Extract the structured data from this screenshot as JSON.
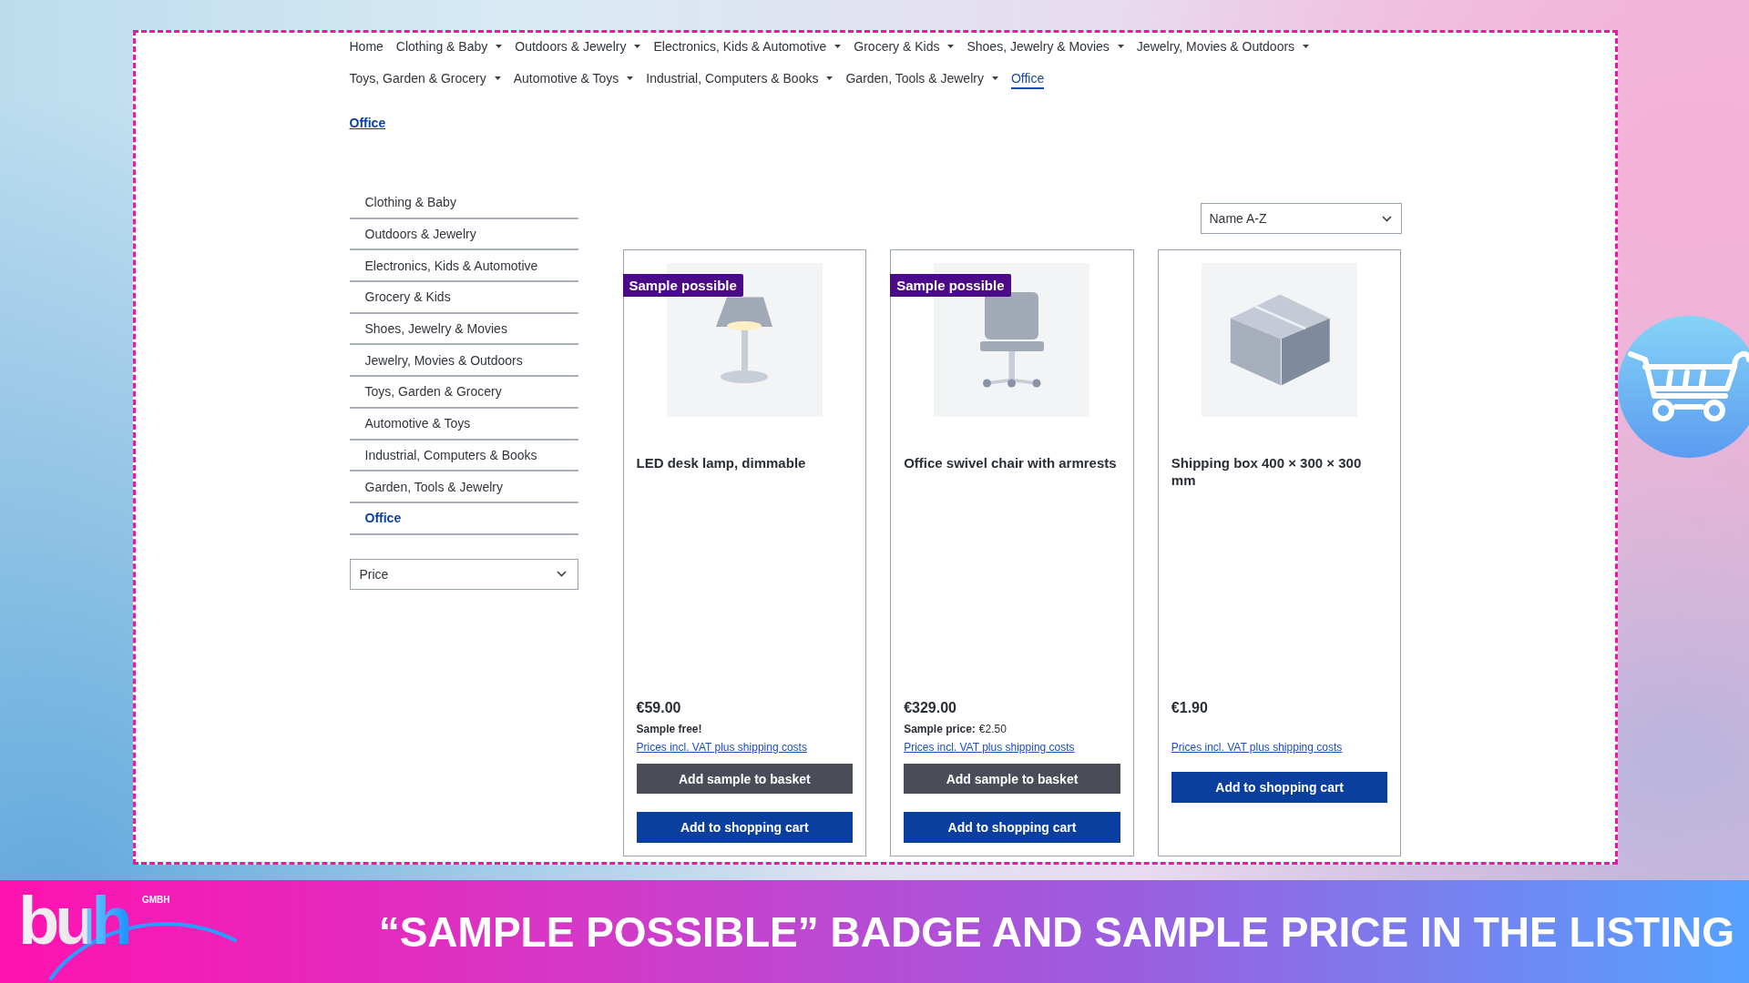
{
  "nav": {
    "items": [
      {
        "label": "Home",
        "has_menu": false,
        "selected": false
      },
      {
        "label": "Clothing & Baby",
        "has_menu": true,
        "selected": false
      },
      {
        "label": "Outdoors & Jewelry",
        "has_menu": true,
        "selected": false
      },
      {
        "label": "Electronics, Kids & Automotive",
        "has_menu": true,
        "selected": false
      },
      {
        "label": "Grocery & Kids",
        "has_menu": true,
        "selected": false
      },
      {
        "label": "Shoes, Jewelry & Movies",
        "has_menu": true,
        "selected": false
      },
      {
        "label": "Jewelry, Movies & Outdoors",
        "has_menu": true,
        "selected": false
      },
      {
        "label": "Toys, Garden & Grocery",
        "has_menu": true,
        "selected": false
      },
      {
        "label": "Automotive & Toys",
        "has_menu": true,
        "selected": false
      },
      {
        "label": "Industrial, Computers & Books",
        "has_menu": true,
        "selected": false
      },
      {
        "label": "Garden, Tools & Jewelry",
        "has_menu": true,
        "selected": false
      },
      {
        "label": "Office",
        "has_menu": false,
        "selected": true
      }
    ]
  },
  "breadcrumb": {
    "label": "Office"
  },
  "sidebar": {
    "categories": [
      {
        "label": "Clothing & Baby",
        "selected": false
      },
      {
        "label": "Outdoors & Jewelry",
        "selected": false
      },
      {
        "label": "Electronics, Kids & Automotive",
        "selected": false
      },
      {
        "label": "Grocery & Kids",
        "selected": false
      },
      {
        "label": "Shoes, Jewelry & Movies",
        "selected": false
      },
      {
        "label": "Jewelry, Movies & Outdoors",
        "selected": false
      },
      {
        "label": "Toys, Garden & Grocery",
        "selected": false
      },
      {
        "label": "Automotive & Toys",
        "selected": false
      },
      {
        "label": "Industrial, Computers & Books",
        "selected": false
      },
      {
        "label": "Garden, Tools & Jewelry",
        "selected": false
      },
      {
        "label": "Office",
        "selected": true
      }
    ],
    "price_filter": {
      "label": "Price"
    }
  },
  "sort": {
    "value": "Name A-Z"
  },
  "products": [
    {
      "badge": "Sample possible",
      "title": "LED desk lamp, dimmable",
      "price": "€59.00",
      "sample_label": "Sample free!",
      "price_note": "Prices incl. VAT plus shipping costs",
      "sample_button": "Add sample to basket",
      "cart_button": "Add to shopping cart"
    },
    {
      "badge": "Sample possible",
      "title": "Office swivel chair with armrests",
      "price": "€329.00",
      "sample_label": "Sample price:",
      "sample_price": "€2.50",
      "price_note": "Prices incl. VAT plus shipping costs",
      "sample_button": "Add sample to basket",
      "cart_button": "Add to shopping cart"
    },
    {
      "title": "Shipping box 400 × 300 × 300 mm",
      "price": "€1.90",
      "price_note": "Prices incl. VAT plus shipping costs",
      "cart_button": "Add to shopping cart"
    }
  ],
  "banner": {
    "logo": "buh",
    "logo_suffix": "GMBH",
    "caption": "“SAMPLE POSSIBLE” BADGE AND SAMPLE PRICE IN THE LISTING"
  }
}
